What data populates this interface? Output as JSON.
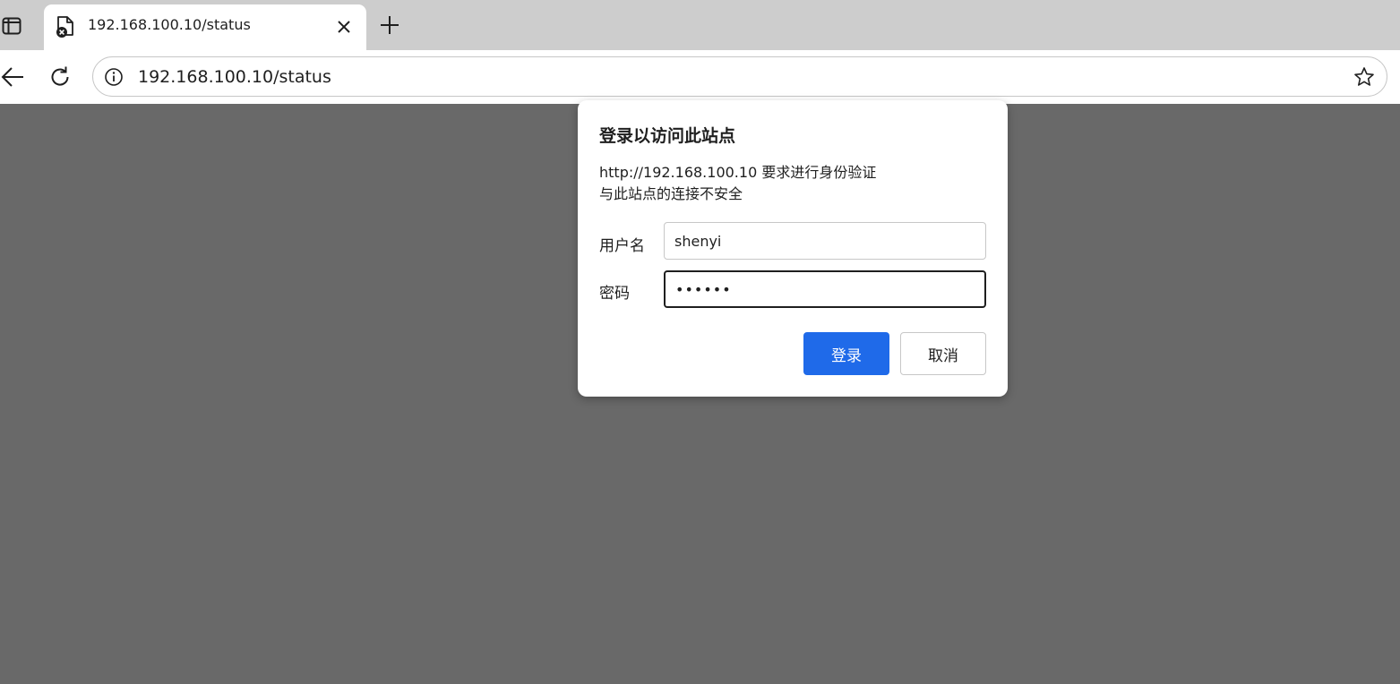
{
  "browser": {
    "tab": {
      "title": "192.168.100.10/status"
    },
    "omnibox": {
      "url": "192.168.100.10/status"
    },
    "icons": {
      "tab_actions": "tab-actions-icon",
      "favicon": "page-error-icon",
      "tab_close": "close-icon",
      "new_tab": "plus-icon",
      "back": "back-arrow-icon",
      "reload": "reload-icon",
      "site_info": "info-icon",
      "favorite": "star-icon"
    }
  },
  "auth_dialog": {
    "title": "登录以访问此站点",
    "message_line1": "http://192.168.100.10 要求进行身份验证",
    "message_line2": "与此站点的连接不安全",
    "username_label": "用户名",
    "username_value": "shenyi",
    "password_label": "密码",
    "password_value": "••••••",
    "login_button": "登录",
    "cancel_button": "取消"
  },
  "colors": {
    "accent": "#1f6ae9",
    "page_background": "#696969",
    "tabstrip_background": "#cdcdcd"
  }
}
